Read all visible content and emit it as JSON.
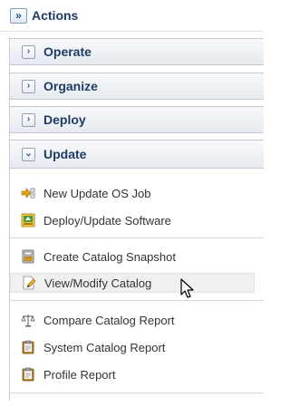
{
  "header": {
    "title": "Actions",
    "expand_glyph": "»"
  },
  "panes": [
    {
      "label": "Operate",
      "state": "collapsed",
      "chevron": "›"
    },
    {
      "label": "Organize",
      "state": "collapsed",
      "chevron": "›"
    },
    {
      "label": "Deploy",
      "state": "collapsed",
      "chevron": "›"
    },
    {
      "label": "Update",
      "state": "expanded",
      "chevron": "⌄"
    }
  ],
  "update_items": [
    {
      "label": "New Update OS Job",
      "icon": "new-update-os-job-icon"
    },
    {
      "label": "Deploy/Update Software",
      "icon": "deploy-update-software-icon"
    },
    {
      "label": "Create Catalog Snapshot",
      "icon": "catalog-snapshot-icon"
    },
    {
      "label": "View/Modify Catalog",
      "icon": "edit-catalog-icon",
      "hovered": true
    },
    {
      "label": "Compare Catalog Report",
      "icon": "compare-scales-icon"
    },
    {
      "label": "System Catalog Report",
      "icon": "report-clipboard-icon"
    },
    {
      "label": "Profile Report",
      "icon": "report-clipboard-icon"
    }
  ],
  "colors": {
    "header_text": "#1f3d63",
    "accent_blue": "#2b5d92",
    "icon_gold": "#e3a21a",
    "icon_green": "#4a9a3c"
  }
}
